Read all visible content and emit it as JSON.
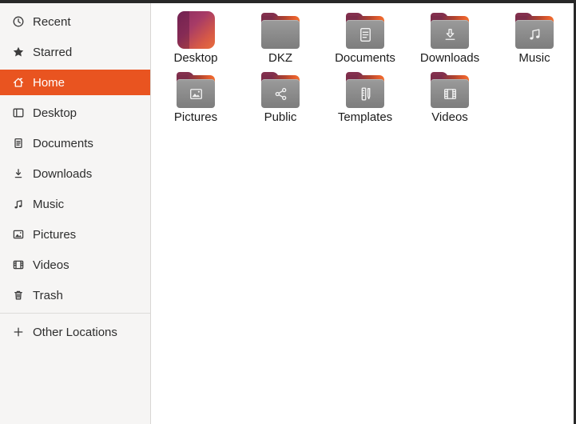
{
  "colors": {
    "accent_orange": "#E95420",
    "edge_dark": "#282828",
    "sidebar_bg": "#f6f5f4",
    "main_bg": "#ffffff",
    "folder_body_gray": "#8d8d8d",
    "folder_tab_maroon": "#7c2d4a",
    "folder_strip_orange": "#ee7031",
    "sidebar_text": "#2e2e2e"
  },
  "sidebar": {
    "items": [
      {
        "label": "Recent",
        "icon": "clock-icon",
        "active": false
      },
      {
        "label": "Starred",
        "icon": "star-icon",
        "active": false
      },
      {
        "label": "Home",
        "icon": "home-icon",
        "active": true
      },
      {
        "label": "Desktop",
        "icon": "desktop-panel-icon",
        "active": false
      },
      {
        "label": "Documents",
        "icon": "document-icon",
        "active": false
      },
      {
        "label": "Downloads",
        "icon": "download-arrow-icon",
        "active": false
      },
      {
        "label": "Music",
        "icon": "music-note-icon",
        "active": false
      },
      {
        "label": "Pictures",
        "icon": "picture-icon",
        "active": false
      },
      {
        "label": "Videos",
        "icon": "film-strip-icon",
        "active": false
      },
      {
        "label": "Trash",
        "icon": "trash-can-icon",
        "active": false
      }
    ],
    "other_locations": {
      "label": "Other Locations",
      "icon": "plus-icon"
    }
  },
  "main": {
    "items": [
      {
        "label": "Desktop",
        "type": "wallpaper-thumbnail"
      },
      {
        "label": "DKZ",
        "type": "folder-plain"
      },
      {
        "label": "Documents",
        "type": "folder-documents"
      },
      {
        "label": "Downloads",
        "type": "folder-downloads"
      },
      {
        "label": "Music",
        "type": "folder-music"
      },
      {
        "label": "Pictures",
        "type": "folder-pictures"
      },
      {
        "label": "Public",
        "type": "folder-share"
      },
      {
        "label": "Templates",
        "type": "folder-templates"
      },
      {
        "label": "Videos",
        "type": "folder-videos"
      }
    ]
  }
}
